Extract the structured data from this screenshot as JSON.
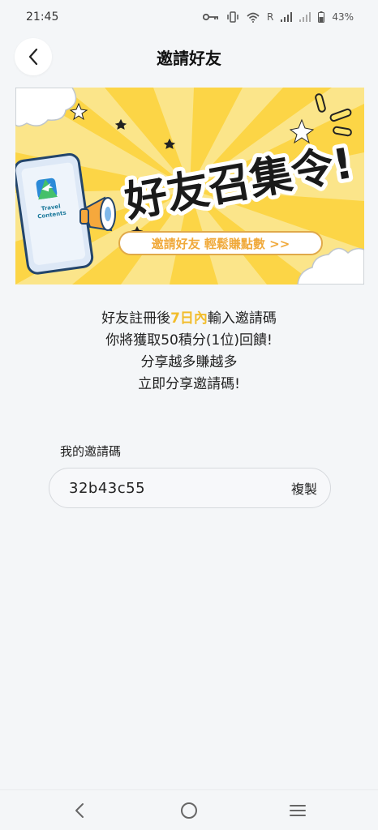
{
  "status_bar": {
    "time": "21:45",
    "carrier_r": "R",
    "battery": "43%"
  },
  "header": {
    "title": "邀請好友",
    "back_icon": "chevron-left-icon"
  },
  "banner": {
    "headline": "好友召集令!",
    "cta": "邀請好友 輕鬆賺點數 >>",
    "logo_line1": "Travel",
    "logo_line2": "Contents",
    "colors": {
      "background": "#fbe58a",
      "ray": "#fcd546",
      "cta_text": "#f0a93a",
      "headline": "#1a1a1a"
    }
  },
  "description": {
    "line1_before": "好友註冊後",
    "line1_highlight": "7日內",
    "line1_after": "輸入邀請碼",
    "line2": "你將獲取50積分(1位)回饋!",
    "line3": "分享越多賺越多",
    "line4": "立即分享邀請碼!"
  },
  "invite_code": {
    "label": "我的邀請碼",
    "value": "32b43c55",
    "copy_label": "複製"
  },
  "colors": {
    "highlight": "#f2bd2c",
    "page_bg": "#f4f6f8"
  },
  "nav": {
    "back_icon": "nav-back-icon",
    "home_icon": "nav-home-icon",
    "recents_icon": "nav-recents-icon"
  }
}
